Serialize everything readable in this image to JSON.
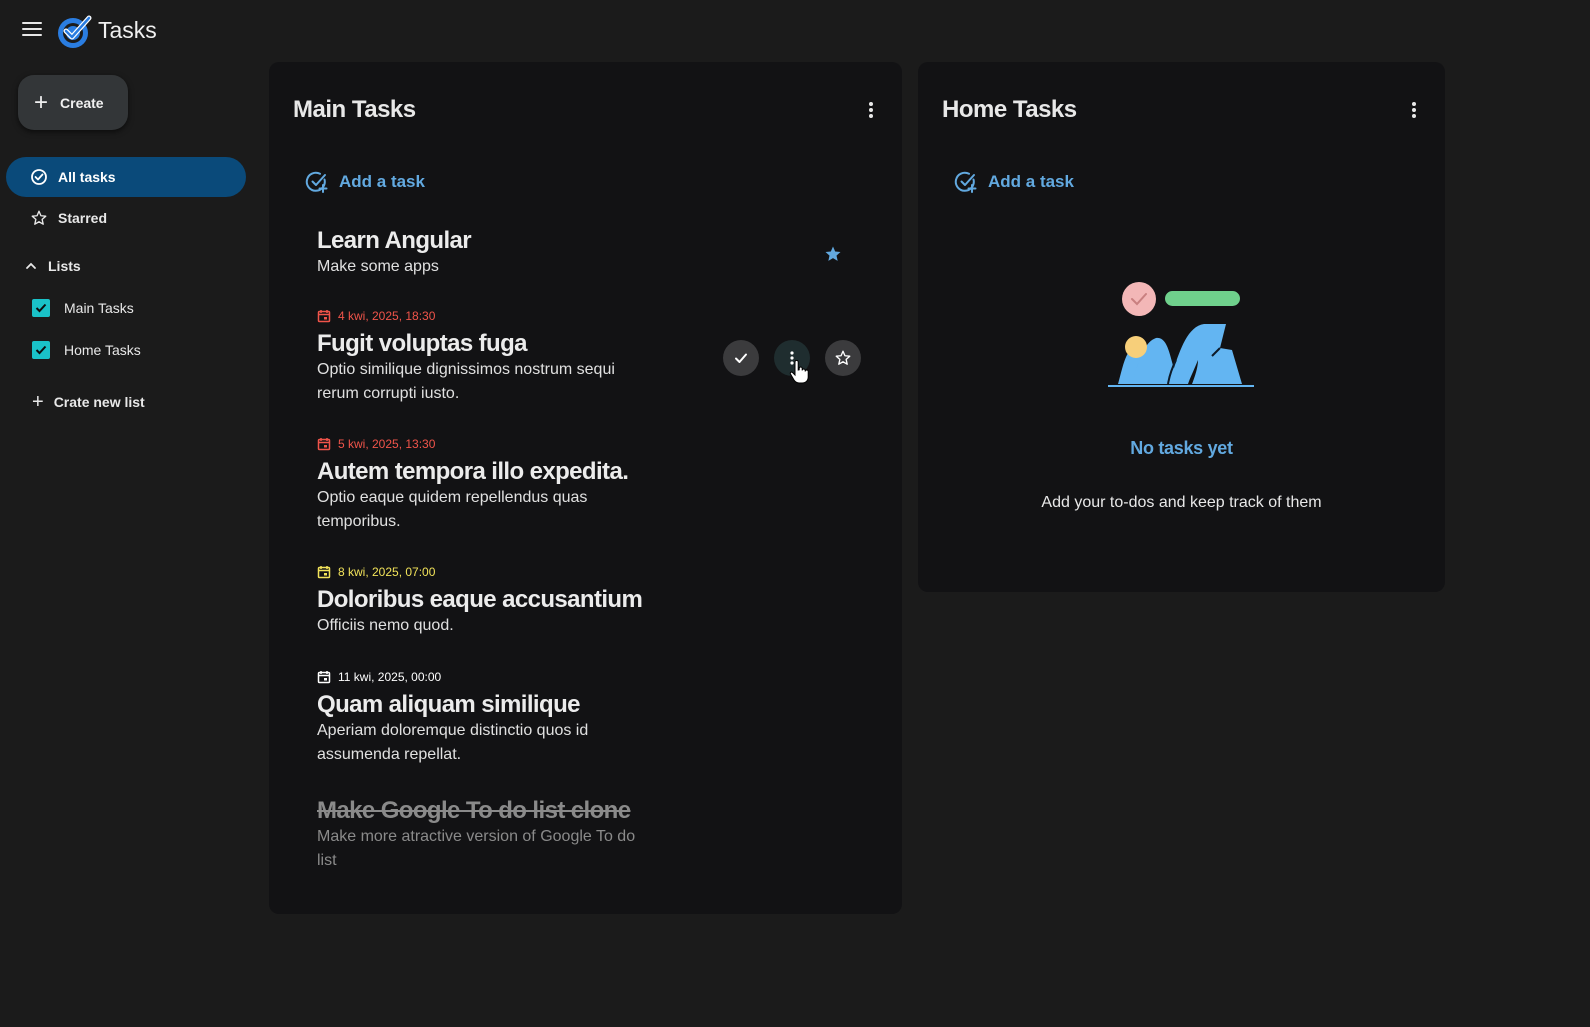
{
  "app": {
    "title": "Tasks"
  },
  "sidebar": {
    "create_label": "Create",
    "nav": [
      {
        "label": "All tasks",
        "icon": "check-circle-icon",
        "active": true
      },
      {
        "label": "Starred",
        "icon": "star-outline-icon",
        "active": false
      }
    ],
    "lists_label": "Lists",
    "lists": [
      {
        "label": "Main Tasks",
        "checked": true
      },
      {
        "label": "Home Tasks",
        "checked": true
      }
    ],
    "create_list_label": "Crate new list"
  },
  "main_panel": {
    "title": "Main Tasks",
    "add_task_label": "Add a task",
    "tasks": [
      {
        "date": "",
        "title": "Learn Angular",
        "desc": "Make some apps",
        "starred": true,
        "done": false
      },
      {
        "date": "4 kwi, 2025, 18:30",
        "date_color": "#f0544a",
        "title": "Fugit voluptas fuga",
        "desc": "Optio similique dignissimos nostrum sequi rerum corrupti iusto.",
        "starred": false,
        "done": false
      },
      {
        "date": "5 kwi, 2025, 13:30",
        "date_color": "#f0544a",
        "title": "Autem tempora illo expedita.",
        "desc": "Optio eaque quidem repellendus quas temporibus.",
        "starred": false,
        "done": false
      },
      {
        "date": "8 kwi, 2025, 07:00",
        "date_color": "#f2e35a",
        "title": "Doloribus eaque accusantium",
        "desc": "Officiis nemo quod.",
        "starred": false,
        "done": false
      },
      {
        "date": "11 kwi, 2025, 00:00",
        "date_color": "#ffffff",
        "title": "Quam aliquam similique",
        "desc": "Aperiam doloremque distinctio quos id assumenda repellat.",
        "starred": false,
        "done": false
      },
      {
        "date": "",
        "title": "Make Google To do list clone",
        "desc": "Make more atractive version of Google To do list",
        "starred": false,
        "done": true
      }
    ]
  },
  "home_panel": {
    "title": "Home Tasks",
    "add_task_label": "Add a task",
    "empty_title": "No tasks yet",
    "empty_subtitle": "Add your to-dos and keep track of them"
  },
  "colors": {
    "accent": "#62a9e0",
    "active_nav": "#0a4a7a",
    "checkbox": "#1ac2c8",
    "overdue": "#f0544a",
    "soon": "#f2e35a"
  }
}
